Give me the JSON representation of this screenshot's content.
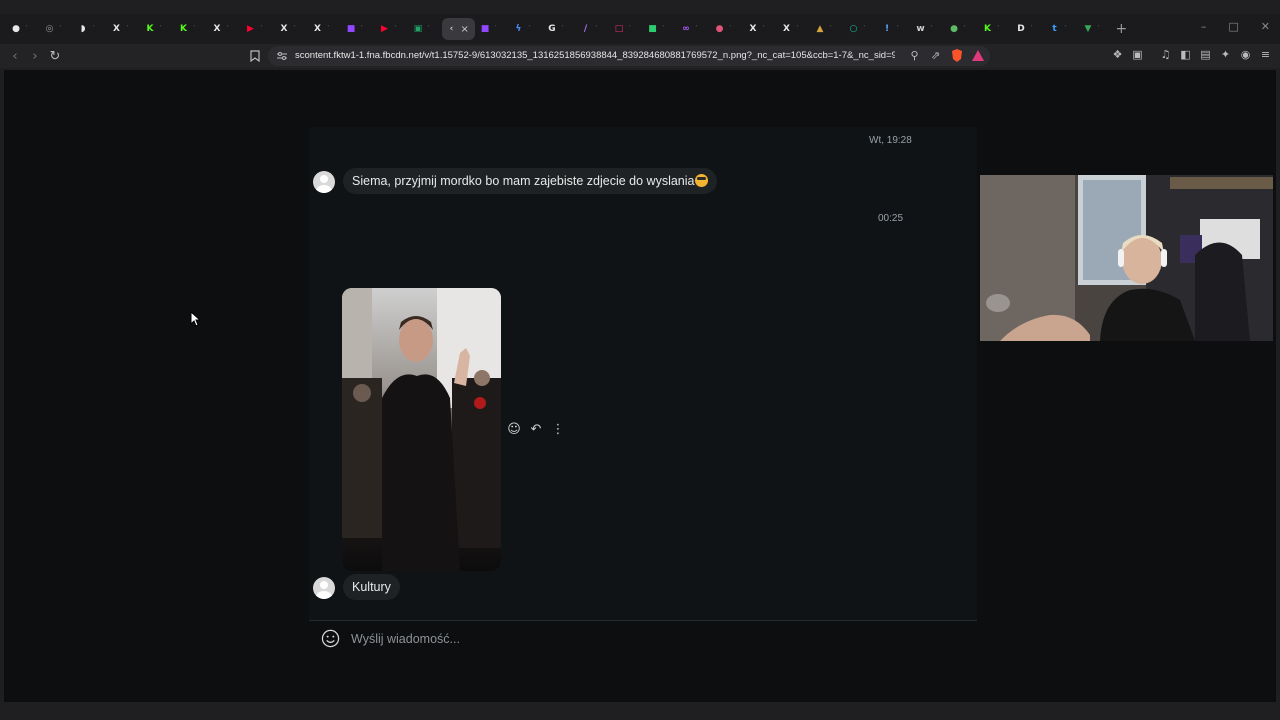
{
  "browser": {
    "tabs": [
      {
        "icon": "record-icon",
        "color": "#e8e8e8",
        "glyph": "●"
      },
      {
        "icon": "globe-icon",
        "color": "#9a9a9a",
        "glyph": "◎"
      },
      {
        "icon": "chat-icon",
        "color": "#e8e8e8",
        "glyph": "◗"
      },
      {
        "icon": "x-icon",
        "color": "#e8e8e8",
        "glyph": "X"
      },
      {
        "icon": "kick-icon",
        "color": "#53fc18",
        "glyph": "K"
      },
      {
        "icon": "kick-icon",
        "color": "#53fc18",
        "glyph": "K"
      },
      {
        "icon": "x-icon",
        "color": "#e8e8e8",
        "glyph": "X"
      },
      {
        "icon": "youtube-icon",
        "color": "#ff0033",
        "glyph": "▶"
      },
      {
        "icon": "x-icon",
        "color": "#e8e8e8",
        "glyph": "X"
      },
      {
        "icon": "x-icon",
        "color": "#e8e8e8",
        "glyph": "X"
      },
      {
        "icon": "twitch-icon",
        "color": "#9146ff",
        "glyph": "■"
      },
      {
        "icon": "youtube-icon",
        "color": "#ff0033",
        "glyph": "▶"
      },
      {
        "icon": "sheets-icon",
        "color": "#21a366",
        "glyph": "▣"
      },
      {
        "icon": "messenger-icon",
        "color": "#c9c9c9",
        "glyph": "‹"
      },
      {
        "icon": "twitch-icon",
        "color": "#9146ff",
        "glyph": "■"
      },
      {
        "icon": "bolt-icon",
        "color": "#4c8dff",
        "glyph": "ϟ"
      },
      {
        "icon": "google-icon",
        "color": "#e8e8e8",
        "glyph": "G"
      },
      {
        "icon": "pen-icon",
        "color": "#a678ff",
        "glyph": "∕"
      },
      {
        "icon": "instagram-icon",
        "color": "#e1306c",
        "glyph": "□"
      },
      {
        "icon": "green-square-icon",
        "color": "#2ecc71",
        "glyph": "■"
      },
      {
        "icon": "link-icon",
        "color": "#b05cff",
        "glyph": "∞"
      },
      {
        "icon": "paint-icon",
        "color": "#e05577",
        "glyph": "●"
      },
      {
        "icon": "x-icon",
        "color": "#e8e8e8",
        "glyph": "X"
      },
      {
        "icon": "x-icon",
        "color": "#e8e8e8",
        "glyph": "X"
      },
      {
        "icon": "hat-icon",
        "color": "#d4a440",
        "glyph": "▲"
      },
      {
        "icon": "ring-icon",
        "color": "#1abc9c",
        "glyph": "○"
      },
      {
        "icon": "pin-icon",
        "color": "#5aa8ff",
        "glyph": "!"
      },
      {
        "icon": "ws-icon",
        "color": "#d0d0d0",
        "glyph": "w"
      },
      {
        "icon": "cloud-icon",
        "color": "#5dbb63",
        "glyph": "●"
      },
      {
        "icon": "kick-icon",
        "color": "#53fc18",
        "glyph": "K"
      },
      {
        "icon": "d-icon",
        "color": "#e8e8e8",
        "glyph": "D"
      },
      {
        "icon": "t-icon",
        "color": "#3d9eff",
        "glyph": "t"
      },
      {
        "icon": "maps-icon",
        "color": "#34a853",
        "glyph": "▼"
      }
    ],
    "active_tab_close": "×",
    "new_tab": "+",
    "url": "scontent.fktw1-1.fna.fbcdn.net/v/t1.15752-9/613032135_1316251856938844_839284680881769572_n.png?_nc_cat=105&ccb=1-7&_nc_sid=9f8..."
  },
  "chat": {
    "timestamp_1": "Wt, 19:28",
    "message_1": "Siema, przyjmij mordko bo mam zajebiste zdjecie do wyslania",
    "timestamp_2": "00:25",
    "message_2": "Kultury",
    "composer_placeholder": "Wyślij wiadomość..."
  }
}
